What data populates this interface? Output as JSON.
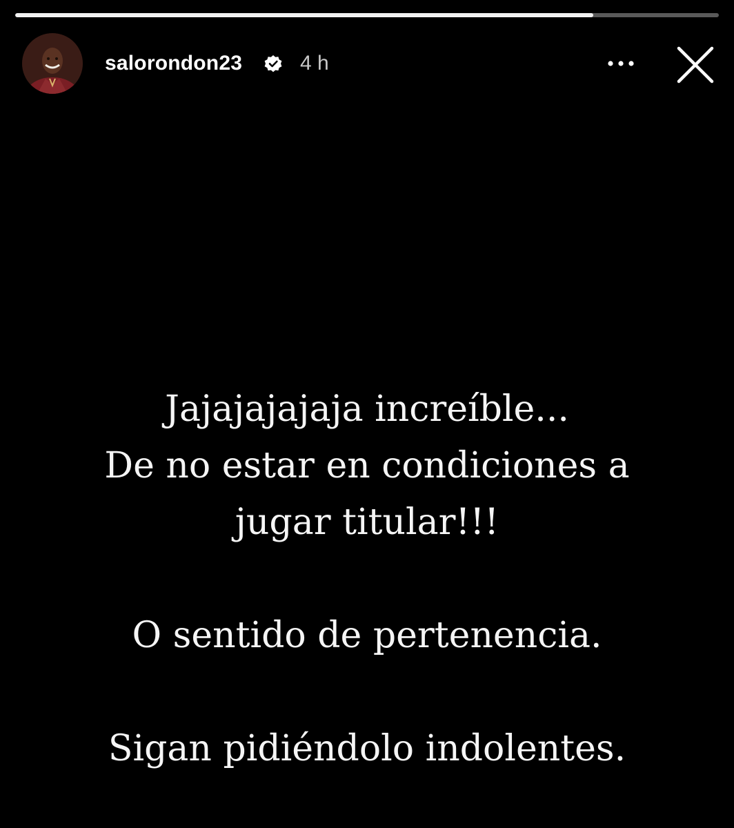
{
  "story": {
    "progress": 0.822,
    "author": {
      "username": "salorondon23",
      "verified": true,
      "time_ago": "4 h"
    },
    "controls": {
      "more_icon": "more-horizontal-icon",
      "close_icon": "close-icon"
    },
    "text_lines": [
      "Jajajajajaja increíble...",
      "De no estar en condiciones a",
      "jugar titular!!!",
      "",
      "O sentido de pertenencia.",
      "",
      "Sigan pidiéndolo indolentes."
    ]
  },
  "colors": {
    "background": "#000000",
    "progress_fill": "#f2f2f2",
    "progress_track": "#595959",
    "text": "#f5f5f5"
  }
}
